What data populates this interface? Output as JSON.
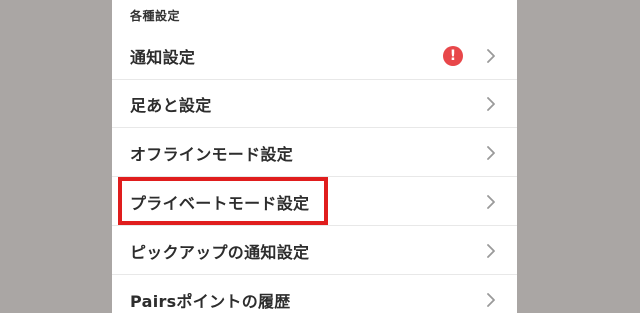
{
  "section": {
    "title": "各種設定"
  },
  "rows": [
    {
      "label": "通知設定",
      "has_alert": true,
      "alert_symbol": "!"
    },
    {
      "label": "足あと設定"
    },
    {
      "label": "オフラインモード設定"
    },
    {
      "label": "プライベートモード設定",
      "highlighted": true
    },
    {
      "label": "ピックアップの通知設定"
    },
    {
      "label": "Pairsポイントの履歴"
    }
  ],
  "colors": {
    "background_outer": "#aaa6a4",
    "panel": "#ffffff",
    "text": "#2d2d2d",
    "chevron": "#9a9a9a",
    "alert": "#e8474a",
    "highlight": "#e01d1d",
    "divider": "#e8e8e8"
  },
  "icons": {
    "chevron": "chevron-right-icon",
    "alert": "exclamation-icon"
  }
}
